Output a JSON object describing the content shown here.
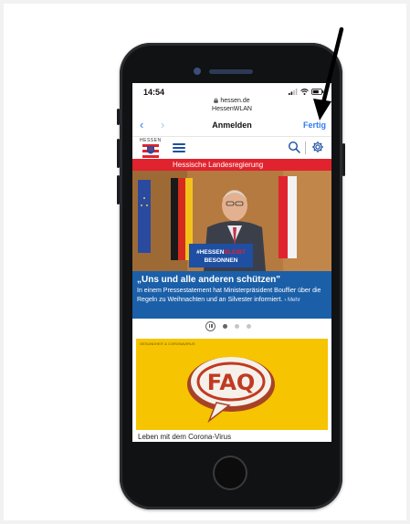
{
  "status_bar": {
    "time": "14:54"
  },
  "browser": {
    "url_host": "hessen.de",
    "network_name": "HessenWLAN",
    "back_symbol": "‹",
    "forward_symbol": "›",
    "page_title": "Anmelden",
    "done_label": "Fertig"
  },
  "site": {
    "logo_text": "HESSEN",
    "banner_text": "Hessische Landesregierung",
    "hero": {
      "sign_line1_a": "#HESSEN",
      "sign_line1_b": "BLEIBT",
      "sign_line2": "BESONNEN"
    },
    "caption": {
      "headline": "„Uns und alle anderen schützen\"",
      "body": "In einem Pressestatement hat Ministerpräsident Bouffier über die Regeln zu Weihnachten und an Silvester informiert.",
      "more_label": "› Mehr"
    },
    "card": {
      "label": "GESUNDHEIT & CORONAVIRUS",
      "badge": "FAQ",
      "title": "Leben mit dem Corona-Virus"
    }
  },
  "colors": {
    "accent_blue": "#2f7bf5",
    "banner_red": "#e0232e",
    "caption_blue": "#1b5fa8",
    "card_yellow": "#f6c400",
    "annotation_arrow": "#000000"
  },
  "icons": [
    "lock-icon",
    "signal-icon",
    "wifi-icon",
    "battery-icon",
    "hamburger-menu-icon",
    "search-icon",
    "gear-icon",
    "pause-icon",
    "annotation-arrow"
  ]
}
